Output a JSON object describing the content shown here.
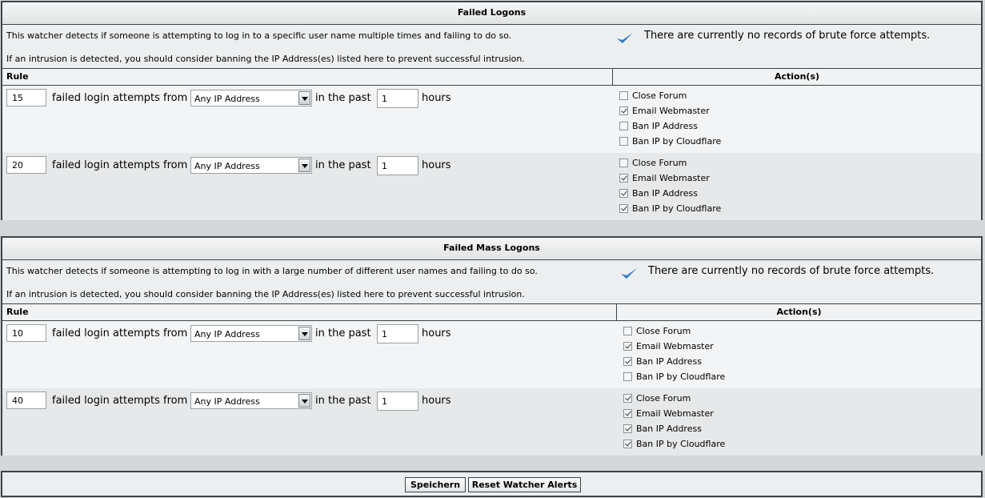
{
  "sections": [
    {
      "title": "Failed Logons",
      "description": "This watcher detects if someone is attempting to log in to a specific user name multiple times and failing to do so.",
      "intrusion_note": "If an intrusion is detected, you should consider banning the IP Address(es) listed here to prevent successful intrusion.",
      "status": "There are currently no records of brute force attempts.",
      "rule_header": "Rule",
      "actions_header": "Action(s)",
      "rules": [
        {
          "count": "15",
          "text_attempts": "failed login attempts from",
          "source": "Any IP Address",
          "text_past": "in the past",
          "hours": "1",
          "text_hours": "hours",
          "actions": [
            {
              "label": "Close Forum",
              "checked": false
            },
            {
              "label": "Email Webmaster",
              "checked": true
            },
            {
              "label": "Ban IP Address",
              "checked": false
            },
            {
              "label": "Ban IP by Cloudflare",
              "checked": false
            }
          ]
        },
        {
          "count": "20",
          "text_attempts": "failed login attempts from",
          "source": "Any IP Address",
          "text_past": "in the past",
          "hours": "1",
          "text_hours": "hours",
          "actions": [
            {
              "label": "Close Forum",
              "checked": false
            },
            {
              "label": "Email Webmaster",
              "checked": true
            },
            {
              "label": "Ban IP Address",
              "checked": true
            },
            {
              "label": "Ban IP by Cloudflare",
              "checked": true
            }
          ]
        }
      ]
    },
    {
      "title": "Failed Mass Logons",
      "description": "This watcher detects if someone is attempting to log in with a large number of different user names and failing to do so.",
      "intrusion_note": "If an intrusion is detected, you should consider banning the IP Address(es) listed here to prevent successful intrusion.",
      "status": "There are currently no records of brute force attempts.",
      "rule_header": "Rule",
      "actions_header": "Action(s)",
      "rules": [
        {
          "count": "10",
          "text_attempts": "failed login attempts from",
          "source": "Any IP Address",
          "text_past": "in the past",
          "hours": "1",
          "text_hours": "hours",
          "actions": [
            {
              "label": "Close Forum",
              "checked": false
            },
            {
              "label": "Email Webmaster",
              "checked": true
            },
            {
              "label": "Ban IP Address",
              "checked": true
            },
            {
              "label": "Ban IP by Cloudflare",
              "checked": false
            }
          ]
        },
        {
          "count": "40",
          "text_attempts": "failed login attempts from",
          "source": "Any IP Address",
          "text_past": "in the past",
          "hours": "1",
          "text_hours": "hours",
          "actions": [
            {
              "label": "Close Forum",
              "checked": true
            },
            {
              "label": "Email Webmaster",
              "checked": true
            },
            {
              "label": "Ban IP Address",
              "checked": true
            },
            {
              "label": "Ban IP by Cloudflare",
              "checked": true
            }
          ]
        }
      ]
    }
  ],
  "footer": {
    "save_label": "Speichern",
    "reset_label": "Reset Watcher Alerts"
  },
  "colors": {
    "check_icon": "#2e7bc4",
    "border": "#3e4447"
  }
}
